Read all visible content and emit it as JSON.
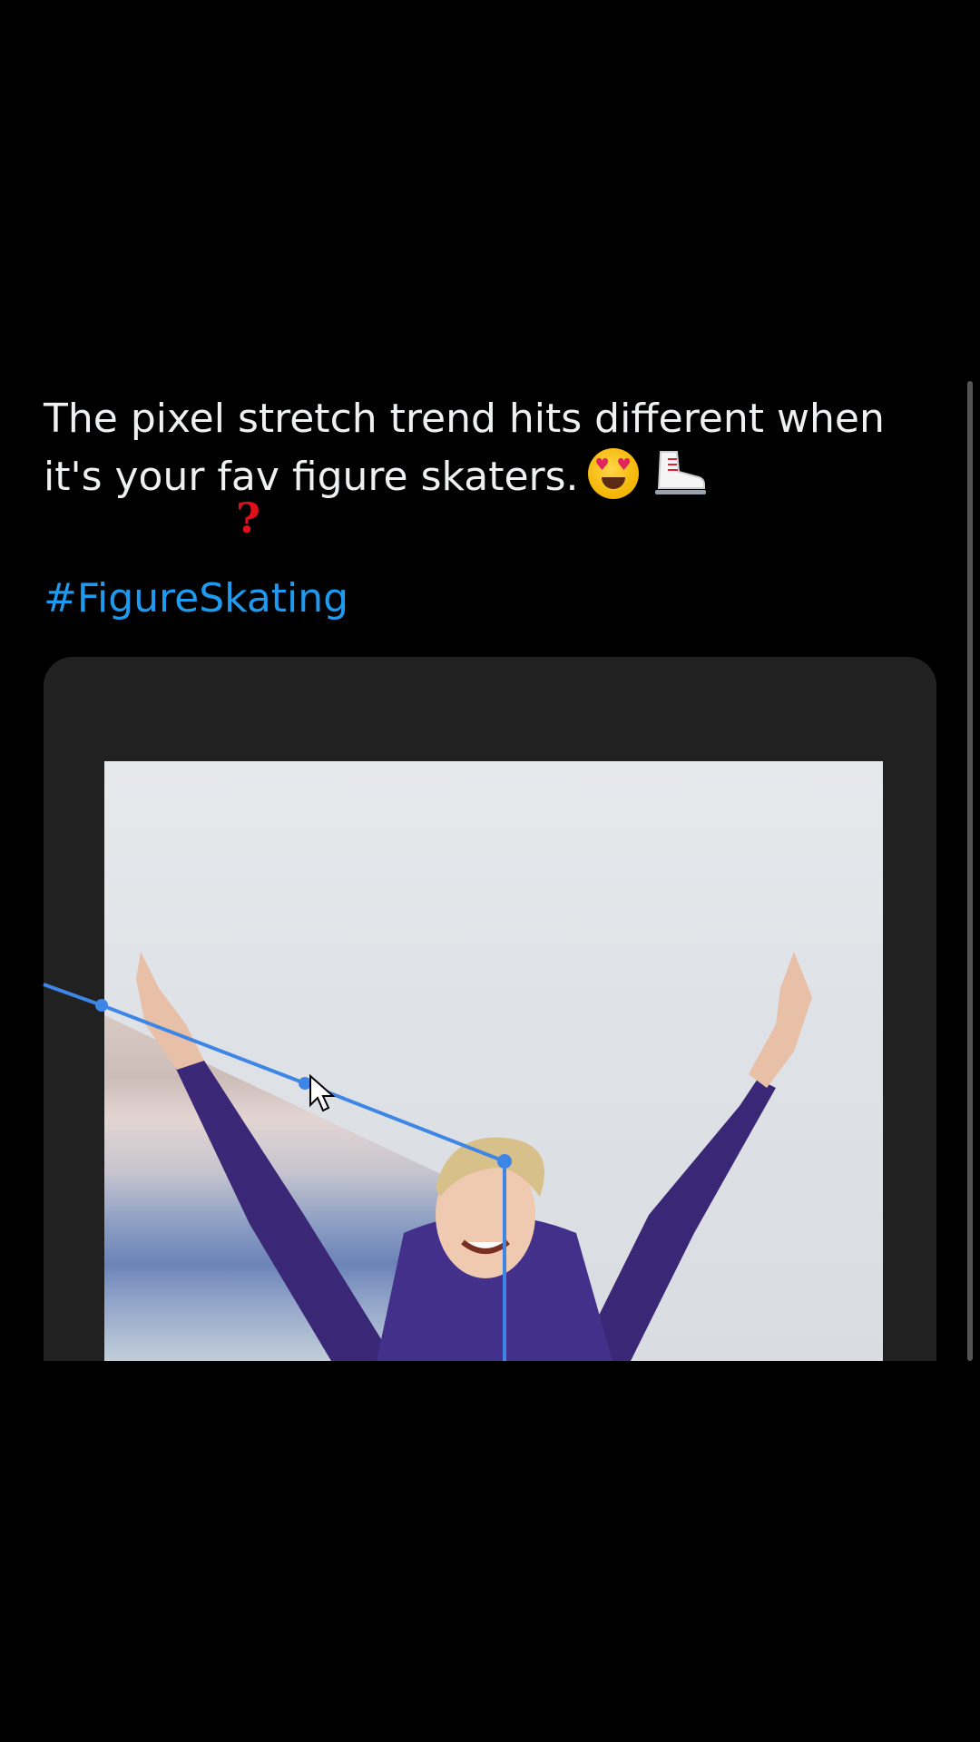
{
  "post": {
    "text_line1": "The pixel stretch trend hits different when",
    "text_line2": "it's your fav figure skaters.",
    "emoji_1": "heart-eyes-face",
    "emoji_2": "ice-skate",
    "hashtag": "#FigureSkating",
    "annotation_mark": "?"
  },
  "colors": {
    "background": "#000000",
    "text": "#eef0f1",
    "link": "#1d9bf0",
    "selection_line": "#3d86e6",
    "annotation": "#e0101a",
    "card": "#212121"
  },
  "media": {
    "description_icon": "figure-skater-photo",
    "tool_overlay": "pixel-stretch-selection"
  }
}
